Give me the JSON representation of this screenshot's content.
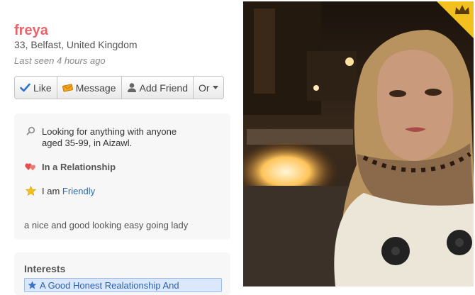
{
  "profile": {
    "name": "freya",
    "subtitle": "33, Belfast, United Kingdom",
    "last_seen": "Last seen 4 hours ago"
  },
  "actions": {
    "like": "Like",
    "message": "Message",
    "add_friend": "Add Friend",
    "or": "Or"
  },
  "details": {
    "looking_for": "Looking for anything with anyone aged 35-99, in Aizawl.",
    "relationship": "In a Relationship",
    "i_am_prefix": "I am",
    "i_am_value": "Friendly",
    "bio": "a nice and good looking easy going lady"
  },
  "interests": {
    "heading": "Interests",
    "items": [
      "A Good Honest Realationship And"
    ]
  },
  "colors": {
    "name": "#e8646a",
    "link": "#2b6cb0",
    "badge": "#f2c01f"
  },
  "icons": [
    "check-icon",
    "message-icon",
    "add-friend-icon",
    "caret-down-icon",
    "search-icon",
    "hearts-icon",
    "star-icon",
    "crown-icon"
  ]
}
